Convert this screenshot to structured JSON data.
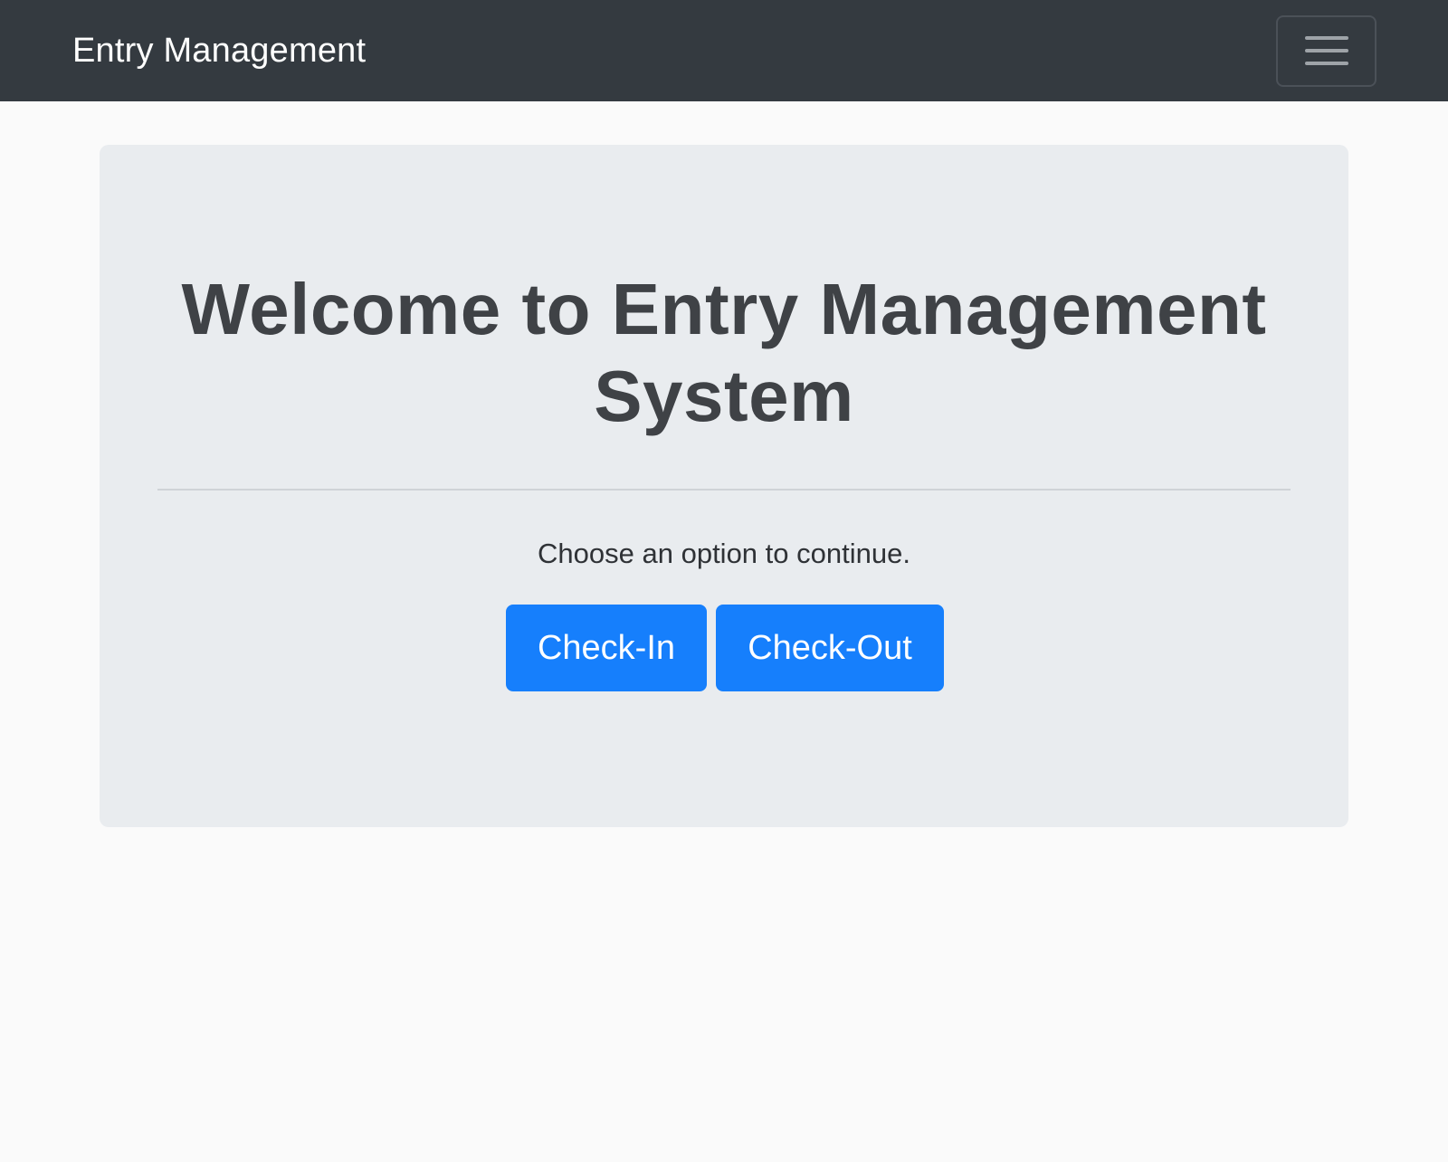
{
  "navbar": {
    "brand": "Entry Management",
    "toggler_icon": "hamburger-menu-icon"
  },
  "hero": {
    "title": "Welcome to Entry Management System",
    "lead": "Choose an option to continue.",
    "buttons": [
      {
        "label": "Check-In"
      },
      {
        "label": "Check-Out"
      }
    ]
  },
  "colors": {
    "navbar_bg": "#343a40",
    "page_bg": "#fafafa",
    "jumbotron_bg": "#e9ecef",
    "primary": "#167ffc"
  }
}
